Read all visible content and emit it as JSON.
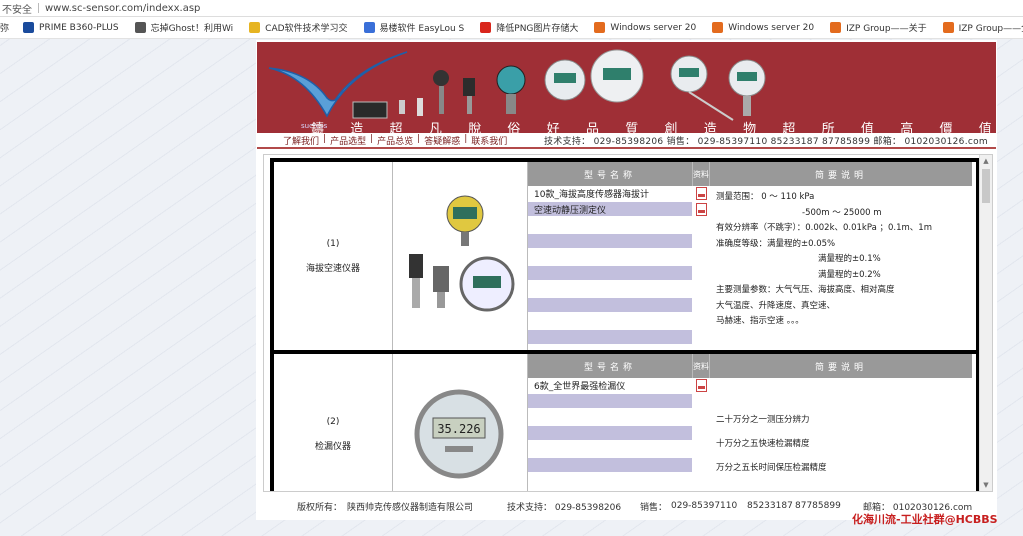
{
  "browser": {
    "insecure_label": "不安全",
    "url": "www.sc-sensor.com/indexx.asp",
    "bookmarks": [
      {
        "label": "PRIME B360-PLUS",
        "color": "#1a4b9c"
      },
      {
        "label": "忘掉Ghost！利用Wi",
        "color": "#555555"
      },
      {
        "label": "CAD软件技术学习交",
        "color": "#e6b422"
      },
      {
        "label": "易楼软件 EasyLou S",
        "color": "#3a6fd8"
      },
      {
        "label": "降低PNG图片存储大",
        "color": "#d9261c"
      },
      {
        "label": "Windows server 20",
        "color": "#e36b1e"
      },
      {
        "label": "Windows server 20",
        "color": "#e36b1e"
      },
      {
        "label": "IZP Group——关于",
        "color": "#e36b1e"
      },
      {
        "label": "IZP Group——全",
        "color": "#e36b1e"
      }
    ],
    "bookmark_leading": "弥"
  },
  "banner": {
    "logo_text": "sucress",
    "slogan": [
      "鑄",
      "造",
      "超",
      "凡",
      "脫",
      "俗",
      "好",
      "品",
      "質",
      "創",
      "造",
      "物",
      "超",
      "所",
      "值",
      "高",
      "價",
      "值"
    ]
  },
  "nav": {
    "links": [
      "了解我们",
      "产品选型",
      "产品总览",
      "答疑解惑",
      "联系我们"
    ],
    "contact": "技术支持： 029-85398206  销售： 029-85397110  85233187  87785899  邮箱： 0102030126.com"
  },
  "headers": {
    "model": "型号名称",
    "doc": "资料",
    "desc": "简要说明"
  },
  "products": [
    {
      "index": "(1)",
      "name": "海拔空速仪器",
      "rows": [
        "10款_海拔高度传感器海拔计",
        "空速动静压测定仪",
        "",
        "",
        "",
        "",
        "",
        "",
        "",
        ""
      ],
      "desc": [
        "测量范围： 0 ～ 110 kPa",
        "-500m ～ 25000 m",
        "有效分辨率（不跳字）：0.002k、0.01kPa ；0.1m、1m",
        "准确度等级：满量程的±0.05%",
        "满量程的±0.1%",
        "满量程的±0.2%",
        "主要测量参数：大气气压、海拔高度、相对高度",
        "大气温度、升降速度、真空速、",
        "马赫速、指示空速 。。。"
      ]
    },
    {
      "index": "(2)",
      "name": "检漏仪器",
      "rows": [
        "6款_全世界最强检漏仪",
        "",
        "",
        "",
        "",
        "",
        ""
      ],
      "desc": [
        "二十万分之一测压分辨力",
        "十万分之五快速检漏精度",
        "万分之五长时间保压检漏精度"
      ],
      "gauge_reading": "35.226"
    }
  ],
  "footer": {
    "copyright_label": "版权所有：",
    "company": "陕西帅克传感仪器制造有限公司",
    "support": "技术支持：  029-85398206",
    "sales_label": "销售：",
    "sales_1": "029-85397110",
    "sales_2": "85233187",
    "sales_3": "87785899",
    "email": "邮箱：  0102030126.com"
  },
  "watermark_brand": "化海川流-工业社群@HCBBS",
  "colors": {
    "banner": "#9f2f36",
    "purple_row": "#c2bfdd",
    "header_gray": "#999999"
  }
}
